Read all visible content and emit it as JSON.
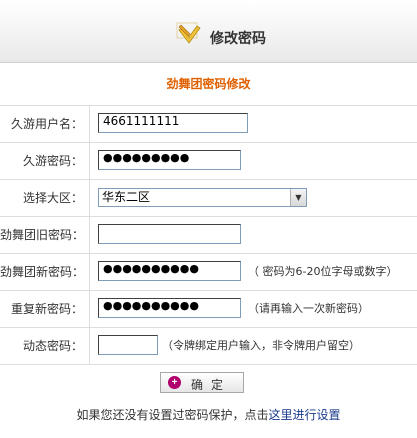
{
  "header": {
    "title": "修改密码"
  },
  "subtitle": "劲舞团密码修改",
  "fields": {
    "username": {
      "label": "久游用户名：",
      "value": "4661111111"
    },
    "password": {
      "label": "久游密码：",
      "value": "●●●●●●●●●"
    },
    "region": {
      "label": "选择大区：",
      "selected": "华东二区"
    },
    "old_pwd": {
      "label": "劲舞团旧密码：",
      "value": ""
    },
    "new_pwd": {
      "label": "劲舞团新密码：",
      "value": "●●●●●●●●●●",
      "hint": "（ 密码为6-20位字母或数字）"
    },
    "repeat_pwd": {
      "label": "重复新密码：",
      "value": "●●●●●●●●●●",
      "hint": "（请再输入一次新密码）"
    },
    "dynamic_pwd": {
      "label": "动态密码：",
      "value": "",
      "hint": "（令牌绑定用户输入，非令牌用户留空）"
    }
  },
  "confirm_button": {
    "label": "确定",
    "icon": "plus-circle-icon",
    "icon_color": "#b0006e"
  },
  "footer": {
    "text": "如果您还没有设置过密码保护，点击",
    "link": "这里进行设置"
  },
  "colors": {
    "subtitle": "#e06000",
    "link": "#1a3a8c"
  }
}
